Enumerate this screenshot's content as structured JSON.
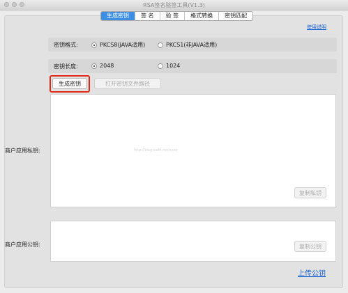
{
  "window": {
    "title": "RSA签名验签工具(V1.3)"
  },
  "tabs": [
    {
      "label": "生成密钥",
      "active": true
    },
    {
      "label": "签 名",
      "active": false
    },
    {
      "label": "验 签",
      "active": false
    },
    {
      "label": "格式转换",
      "active": false
    },
    {
      "label": "密钥匹配",
      "active": false
    }
  ],
  "help_link": "使用说明",
  "key_format": {
    "label": "密钥格式:",
    "options": [
      "PKCS8(JAVA适用)",
      "PKCS1(非JAVA适用)"
    ],
    "selected": "PKCS8(JAVA适用)"
  },
  "key_length": {
    "label": "密钥长度:",
    "options": [
      "2048",
      "1024"
    ],
    "selected": "2048"
  },
  "actions": {
    "generate": "生成密钥",
    "open_path": "打开密钥文件路径"
  },
  "private_key": {
    "label": "商户应用私钥:",
    "value": "",
    "copy": "复制私钥",
    "watermark": "http://blog.csdn.net/xxxx"
  },
  "public_key": {
    "label": "商户应用公钥:",
    "value": "",
    "copy": "复制公钥"
  },
  "upload_link": "上传公钥",
  "colors": {
    "accent": "#3c8fe3",
    "link": "#1a63d6",
    "highlight": "#e02a16"
  }
}
